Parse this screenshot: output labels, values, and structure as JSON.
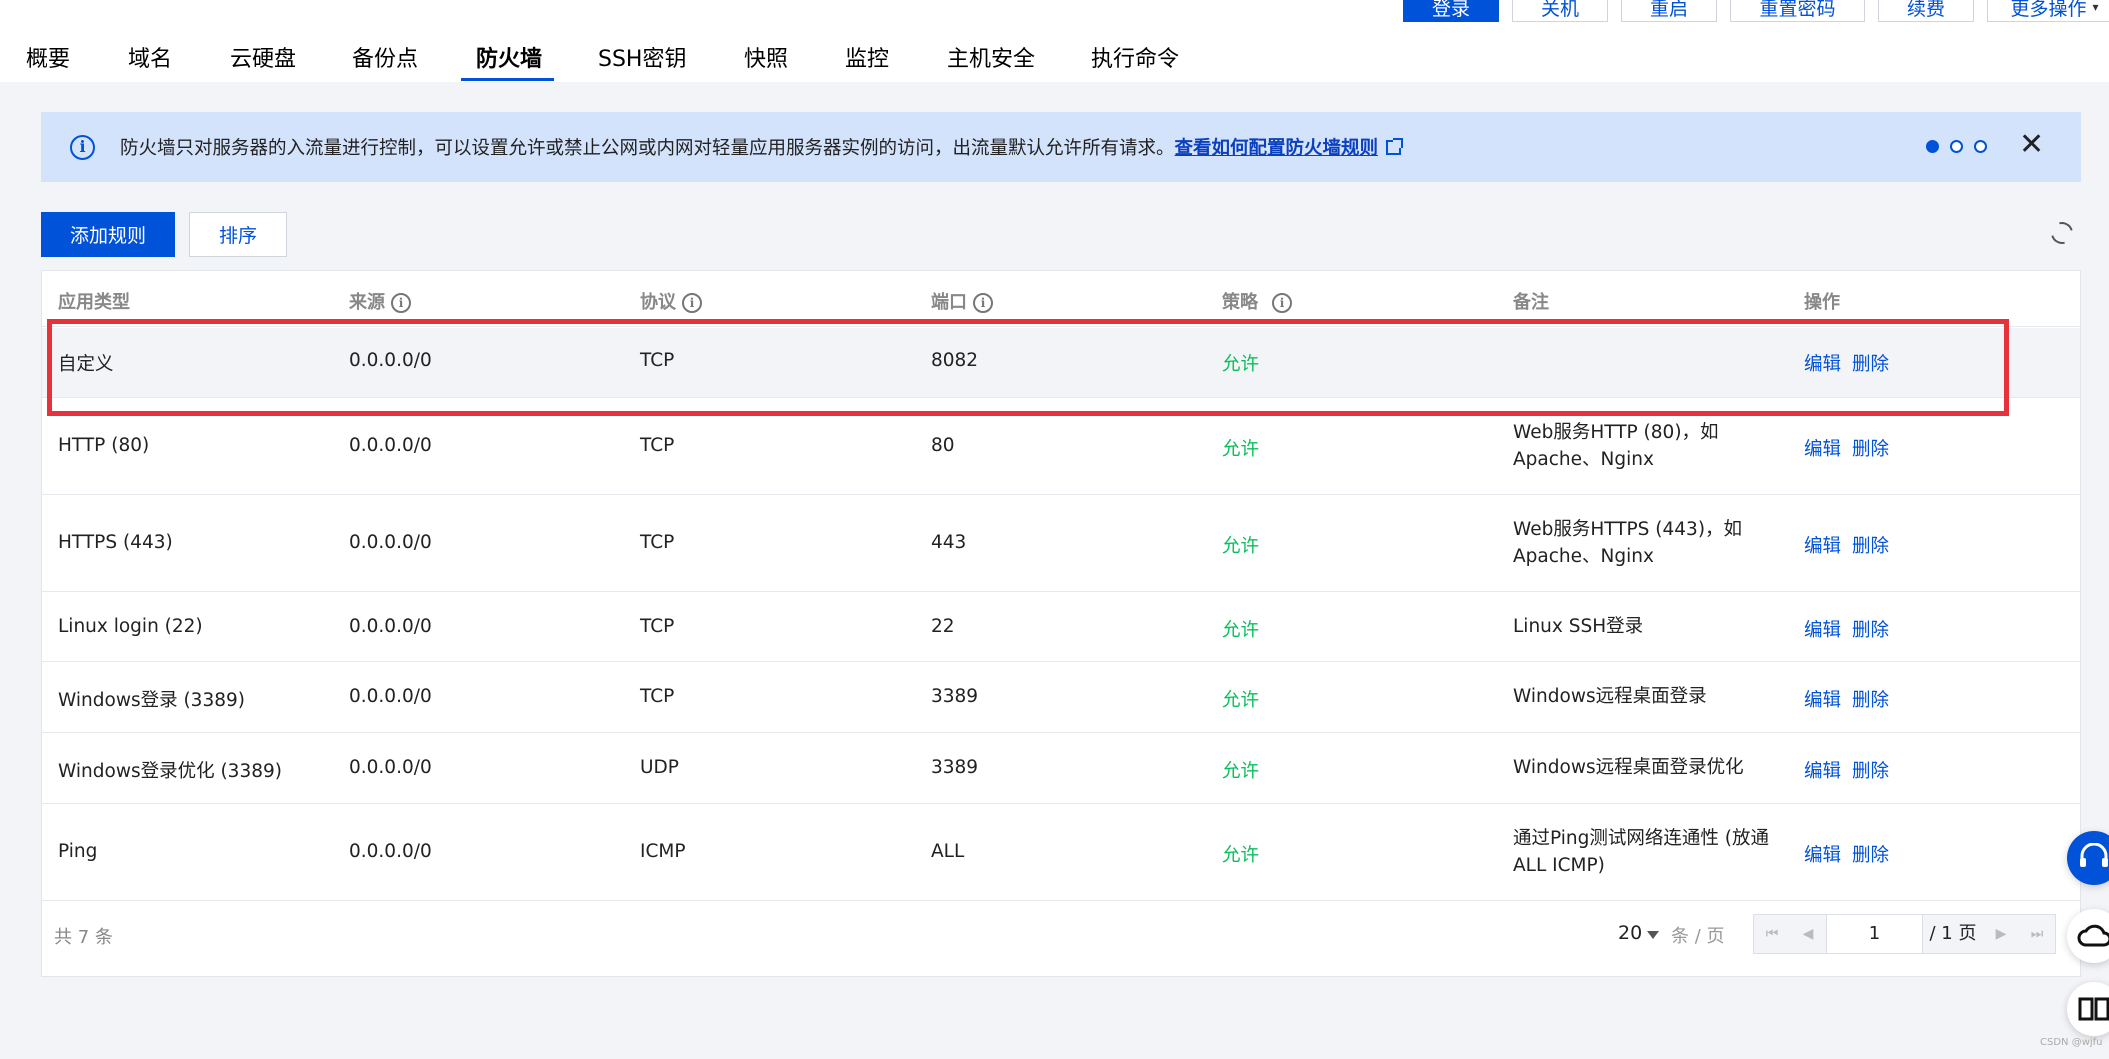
{
  "actions": {
    "login": "登录",
    "shutdown": "关机",
    "restart": "重启",
    "reset_password": "重置密码",
    "renew": "续费",
    "more": "更多操作"
  },
  "tabs": [
    "概要",
    "域名",
    "云硬盘",
    "备份点",
    "防火墙",
    "SSH密钥",
    "快照",
    "监控",
    "主机安全",
    "执行命令"
  ],
  "active_tab": "防火墙",
  "banner": {
    "message": "防火墙只对服务器的入流量进行控制，可以设置允许或禁止公网或内网对轻量应用服务器实例的访问，出流量默认允许所有请求。",
    "link": "查看如何配置防火墙规则"
  },
  "toolbar": {
    "add_rule": "添加规则",
    "sort": "排序"
  },
  "table": {
    "headers": [
      "应用类型",
      "来源",
      "协议",
      "端口",
      "策略",
      "备注",
      "操作"
    ],
    "rows": [
      {
        "app": "自定义",
        "source": "0.0.0.0/0",
        "protocol": "TCP",
        "port": "8082",
        "policy": "允许",
        "note": "",
        "edit": "编辑",
        "delete": "删除"
      },
      {
        "app": "HTTP (80)",
        "source": "0.0.0.0/0",
        "protocol": "TCP",
        "port": "80",
        "policy": "允许",
        "note": "Web服务HTTP (80)，如Apache、Nginx",
        "edit": "编辑",
        "delete": "删除"
      },
      {
        "app": "HTTPS (443)",
        "source": "0.0.0.0/0",
        "protocol": "TCP",
        "port": "443",
        "policy": "允许",
        "note": "Web服务HTTPS (443)，如Apache、Nginx",
        "edit": "编辑",
        "delete": "删除"
      },
      {
        "app": "Linux login (22)",
        "source": "0.0.0.0/0",
        "protocol": "TCP",
        "port": "22",
        "policy": "允许",
        "note": "Linux SSH登录",
        "edit": "编辑",
        "delete": "删除"
      },
      {
        "app": "Windows登录 (3389)",
        "source": "0.0.0.0/0",
        "protocol": "TCP",
        "port": "3389",
        "policy": "允许",
        "note": "Windows远程桌面登录",
        "edit": "编辑",
        "delete": "删除"
      },
      {
        "app": "Windows登录优化 (3389)",
        "source": "0.0.0.0/0",
        "protocol": "UDP",
        "port": "3389",
        "policy": "允许",
        "note": "Windows远程桌面登录优化",
        "edit": "编辑",
        "delete": "删除"
      },
      {
        "app": "Ping",
        "source": "0.0.0.0/0",
        "protocol": "ICMP",
        "port": "ALL",
        "policy": "允许",
        "note": "通过Ping测试网络连通性 (放通ALL ICMP)",
        "edit": "编辑",
        "delete": "删除"
      }
    ]
  },
  "footer": {
    "total": "共 7 条",
    "page_size": "20",
    "page_size_unit": "条 / 页",
    "current_page": "1",
    "total_pages": "/ 1 页"
  },
  "watermark": "CSDN @wjfu",
  "colors": {
    "primary": "#0052d9",
    "allow": "#0abf5b",
    "highlight_box": "#e6333b",
    "banner_bg": "#d4e3fc"
  }
}
